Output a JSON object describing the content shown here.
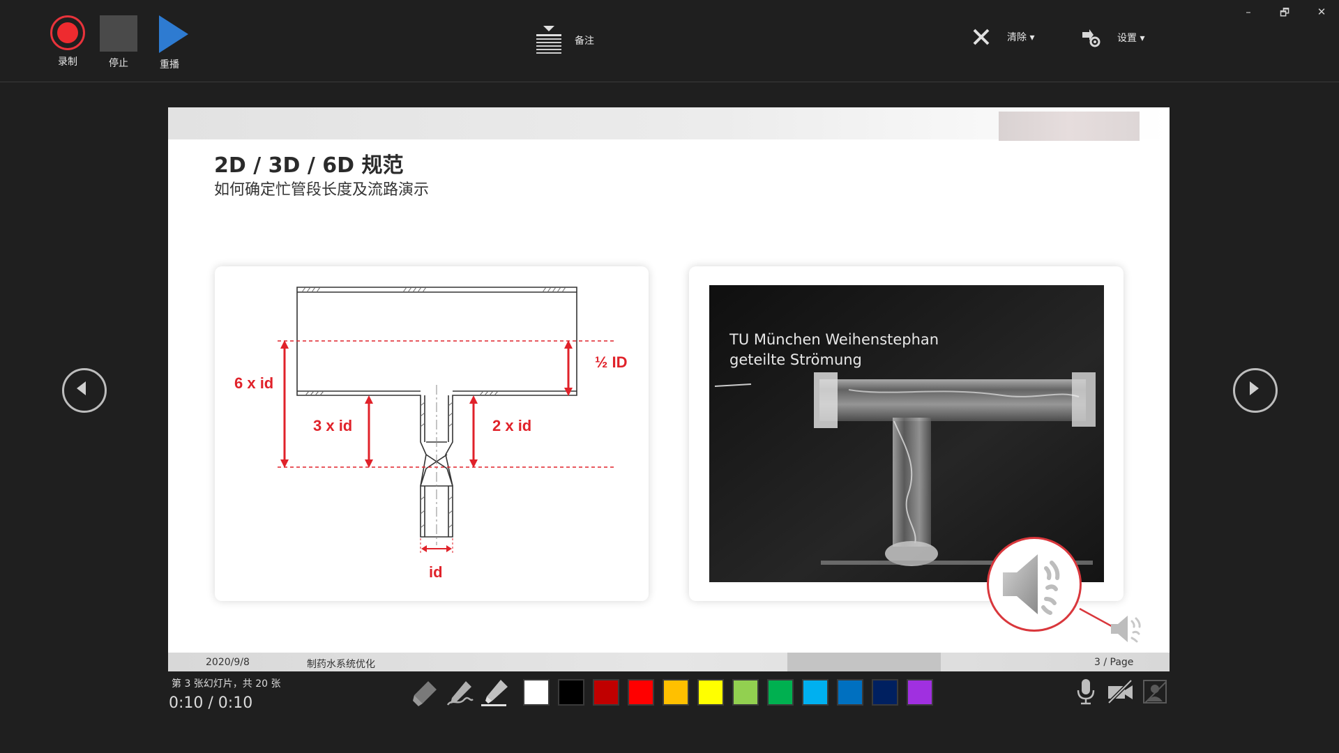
{
  "toolbar": {
    "record_label": "录制",
    "stop_label": "停止",
    "replay_label": "重播",
    "notes_label": "备注",
    "clear_label": "清除 ▾",
    "settings_label": "设置 ▾",
    "colors": {
      "record": "#ee2b2f",
      "replay": "#2e7bd1",
      "stop": "#4a4a4a"
    }
  },
  "window_controls": {
    "minimize": "–",
    "restore": "🗗",
    "close": "✕"
  },
  "slide": {
    "title": "2D / 3D / 6D 规范",
    "subtitle": "如何确定忙管段长度及流路演示",
    "diagram": {
      "labels": {
        "six_id": "6 x id",
        "three_id": "3 x id",
        "two_id": "2 x id",
        "half_id": "½ ID",
        "id": "id"
      }
    },
    "video": {
      "caption_line1": "TU München Weihenstephan",
      "caption_line2": "geteilte Strömung"
    },
    "footer": {
      "date": "2020/9/8",
      "subject": "制药水系统优化",
      "page": "3 / Page"
    }
  },
  "status": {
    "slide_counter": "第 3 张幻灯片，共 20 张",
    "timer": "0:10  /  0:10"
  },
  "ink_colors": [
    "#ffffff",
    "#000000",
    "#c00000",
    "#ff0000",
    "#ffc000",
    "#ffff00",
    "#92d050",
    "#00b050",
    "#00b0f0",
    "#0070c0",
    "#002060",
    "#a030e0"
  ],
  "icons": {
    "nav_prev": "chevron-left-icon",
    "nav_next": "chevron-right-icon",
    "eraser": "eraser-icon",
    "pen": "pen-icon",
    "highlighter": "highlighter-icon",
    "microphone": "microphone-icon",
    "camera_off": "camera-off-icon",
    "camera_preview_off": "camera-preview-off-icon",
    "speaker": "speaker-icon"
  }
}
